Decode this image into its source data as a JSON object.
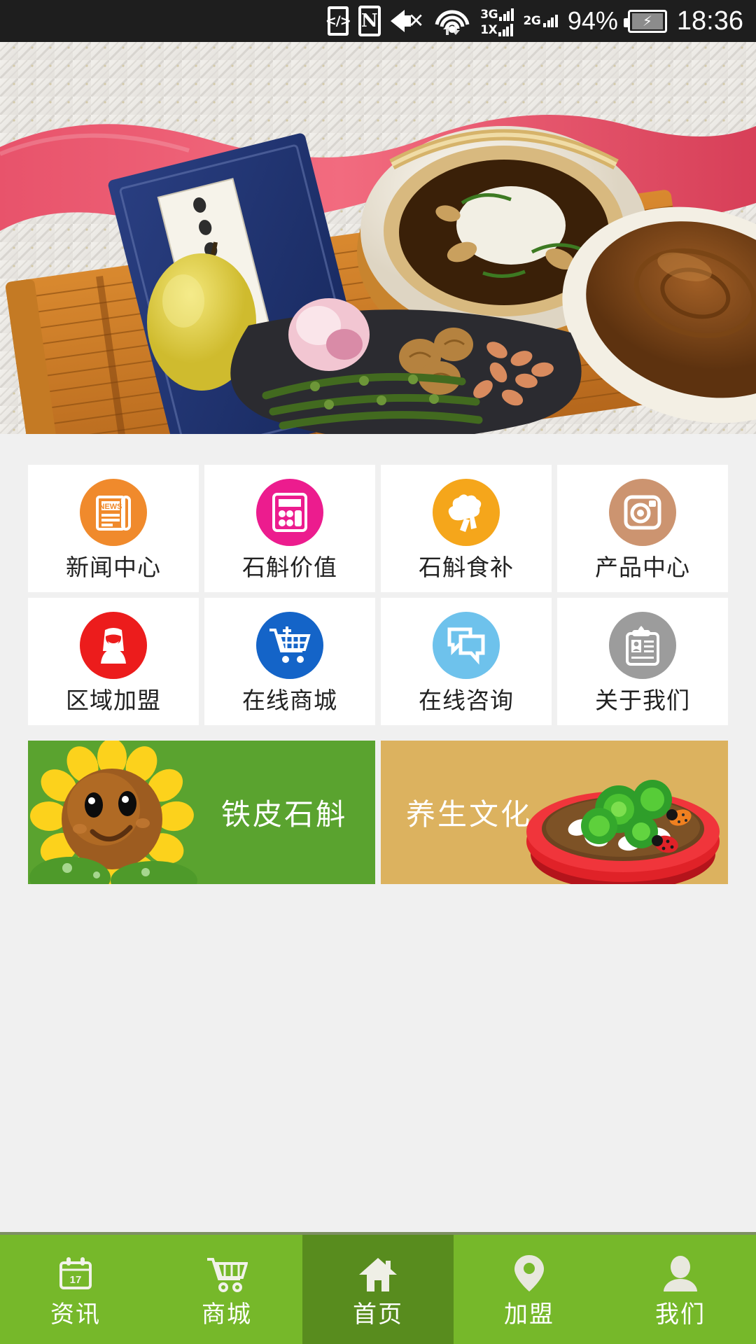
{
  "status_bar": {
    "icons": [
      "usb-debug-icon",
      "nfc-icon",
      "mute-icon",
      "wifi-icon"
    ],
    "usb_glyph": "</>",
    "nfc_glyph": "N",
    "signal_3g_label": "3G",
    "signal_1x_label": "1X",
    "signal_2g_label": "2G",
    "battery_percent": "94%",
    "time": "18:36"
  },
  "hero": {
    "alt": "chinese-herbal-soup-photo"
  },
  "grid": {
    "items": [
      {
        "label": "新闻中心",
        "icon": "news-icon",
        "color": "#f08a2c",
        "glyph": "NEWS"
      },
      {
        "label": "石斛价值",
        "icon": "calculator-icon",
        "color": "#ec1c8e",
        "glyph": ""
      },
      {
        "label": "石斛食补",
        "icon": "broccoli-icon",
        "color": "#f5a61b",
        "glyph": ""
      },
      {
        "label": "产品中心",
        "icon": "camera-icon",
        "color": "#cc9470",
        "glyph": ""
      },
      {
        "label": "区域加盟",
        "icon": "person-red-icon",
        "color": "#ec1c1c",
        "glyph": ""
      },
      {
        "label": "在线商城",
        "icon": "cart-plus-icon",
        "color": "#1464c8",
        "glyph": ""
      },
      {
        "label": "在线咨询",
        "icon": "chat-icon",
        "color": "#6ec2ec",
        "glyph": ""
      },
      {
        "label": "关于我们",
        "icon": "id-card-icon",
        "color": "#9c9c9c",
        "glyph": ""
      }
    ]
  },
  "banners": [
    {
      "title": "铁皮石斛",
      "bg": "#5aa32f",
      "art": "sunflower-illustration"
    },
    {
      "title": "养生文化",
      "bg": "#dcb25f",
      "art": "succulent-pot-illustration"
    }
  ],
  "tabbar": {
    "active_index": 2,
    "tabs": [
      {
        "label": "资讯",
        "icon": "calendar-icon",
        "badge": "17"
      },
      {
        "label": "商城",
        "icon": "cart-icon",
        "badge": ""
      },
      {
        "label": "首页",
        "icon": "home-icon",
        "badge": ""
      },
      {
        "label": "加盟",
        "icon": "location-pin-icon",
        "badge": ""
      },
      {
        "label": "我们",
        "icon": "user-icon",
        "badge": ""
      }
    ]
  },
  "colors": {
    "tab_bg": "#76b82a",
    "tab_active_bg": "#588c1e",
    "page_bg": "#f0f0f0",
    "card_bg": "#ffffff"
  }
}
